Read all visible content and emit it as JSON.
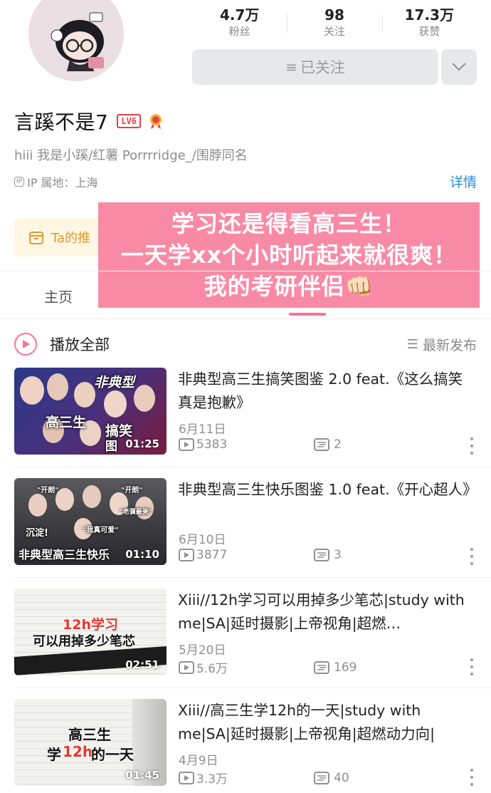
{
  "profile": {
    "name": "言蹊不是7",
    "level_badge": "LV6",
    "bio": "hiii 我是小蹊/红薯 Porrrridge_/围脖同名",
    "ip_tag": "IP",
    "ip_location": "IP 属地：上海",
    "detail_link": "详情"
  },
  "stats": [
    {
      "value": "4.7万",
      "label": "粉丝"
    },
    {
      "value": "98",
      "label": "关注"
    },
    {
      "value": "17.3万",
      "label": "获赞"
    }
  ],
  "follow_button": {
    "label": "已关注"
  },
  "recommend_strip": {
    "label": "Ta的推"
  },
  "overlay_caption": [
    "学习还是得看高三生！",
    "一天学xx个小时听起来就很爽！",
    "我的考研伴侣👊🏻"
  ],
  "tabs": {
    "home": "主页"
  },
  "list_header": {
    "play_all": "播放全部",
    "sort": "最新发布"
  },
  "colors": {
    "accent_pink": "#fb7299",
    "link_blue": "#2a8fd6",
    "overlay_pink": "#f98aa6"
  },
  "videos": [
    {
      "title": "非典型高三生搞笑图鉴 2.0 feat.《这么搞笑真是抱歉》",
      "date": "6月11日",
      "plays": "5383",
      "comments": "2",
      "duration": "01:25",
      "thumb_text": [
        "非典型",
        "高三生",
        "搞笑",
        "图"
      ]
    },
    {
      "title": "非典型高三生快乐图鉴 1.0 feat.《开心超人》",
      "date": "6月10日",
      "plays": "3877",
      "comments": "3",
      "duration": "01:10",
      "thumb_text": [
        "非典型高三生快乐",
        "沉淀!",
        "\"开朗\"",
        "\"我真可爱\"",
        "\"老骥最美\"",
        "\"开朗\""
      ]
    },
    {
      "title": "Xiii//12h学习可以用掉多少笔芯|study with me|SA|延时摄影|上帝视角|超燃…",
      "date": "5月20日",
      "plays": "5.6万",
      "comments": "169",
      "duration": "02:51",
      "thumb_text": [
        "12h学习",
        "可以用掉多少笔芯"
      ]
    },
    {
      "title": "Xiii//高三生学12h的一天|study with me|SA|延时摄影|上帝视角|超燃动力向|",
      "date": "4月9日",
      "plays": "3.3万",
      "comments": "40",
      "duration": "01:45",
      "thumb_text": [
        "高三生",
        "学",
        "12h",
        "的一天"
      ]
    }
  ]
}
